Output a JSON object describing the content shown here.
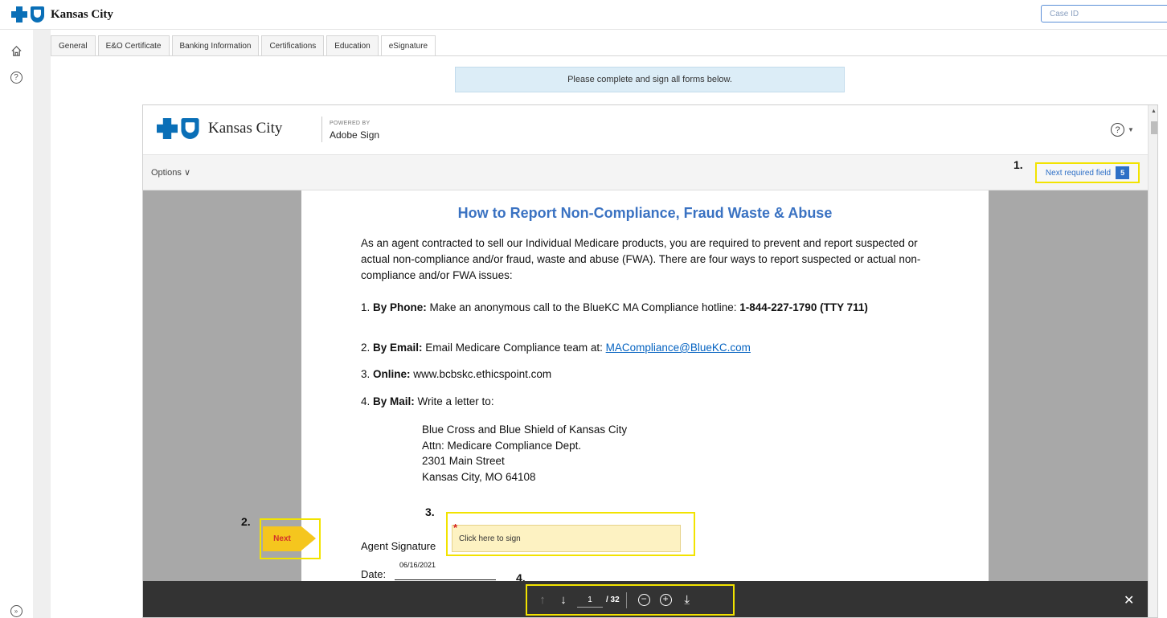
{
  "header": {
    "brand": "Kansas City",
    "case_id_placeholder": "Case ID"
  },
  "tabs": [
    {
      "label": "General"
    },
    {
      "label": "E&O Certificate"
    },
    {
      "label": "Banking Information"
    },
    {
      "label": "Certifications"
    },
    {
      "label": "Education"
    },
    {
      "label": "eSignature"
    }
  ],
  "notice": "Please complete and sign all forms below.",
  "frame": {
    "brand": "Kansas City",
    "powered_by": "POWERED BY",
    "adobe_sign": "Adobe Sign",
    "help": "?",
    "options": "Options ∨",
    "next_required": "Next required field",
    "next_required_count": "5"
  },
  "document": {
    "title": "How to Report Non-Compliance, Fraud Waste & Abuse",
    "intro": "As an agent contracted to sell our Individual Medicare products, you are required to prevent and report suspected or actual non-compliance and/or fraud, waste and abuse (FWA). There are four ways to report suspected or actual non-compliance and/or FWA issues:",
    "item1_num": "1. ",
    "item1_label": "By Phone:",
    "item1_text": " Make an anonymous call to the BlueKC MA Compliance hotline: ",
    "item1_phone": "1-844-227-1790 (TTY 711)",
    "item2_num": "2. ",
    "item2_label": "By Email:",
    "item2_text": " Email Medicare Compliance team at:  ",
    "item2_email": "MACompliance@BlueKC.com",
    "item3_num": "3. ",
    "item3_label": "Online:",
    "item3_text": " www.bcbskc.ethicspoint.com",
    "item4_num": "4. ",
    "item4_label": "By Mail:",
    "item4_text": " Write a letter to:",
    "address": [
      "Blue Cross and Blue Shield of Kansas City",
      "Attn: Medicare Compliance Dept.",
      "2301 Main Street",
      "Kansas City, MO  64108"
    ],
    "agent_signature": "Agent Signature",
    "sign_placeholder": "Click here to sign",
    "required_mark": "*",
    "date_label": "Date:",
    "date_value": "06/16/2021",
    "next_button": "Next"
  },
  "toolbar": {
    "page": "1",
    "total": "/ 32",
    "close": "✕"
  },
  "annotations": {
    "a1": "1.",
    "a2": "2.",
    "a3": "3.",
    "a4": "4."
  }
}
